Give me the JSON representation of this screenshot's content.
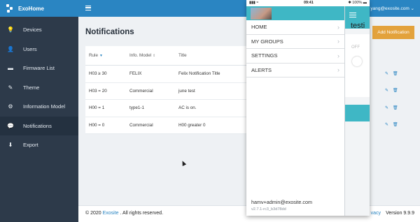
{
  "app": {
    "name": "ExoHome"
  },
  "topbar": {
    "user_email": "yang@exosite.com ⌄"
  },
  "sidebar": {
    "items": [
      {
        "label": "Devices",
        "icon": "lightbulb-icon",
        "glyph": "💡"
      },
      {
        "label": "Users",
        "icon": "user-icon",
        "glyph": "👤"
      },
      {
        "label": "Firmware List",
        "icon": "folder-icon",
        "glyph": "▬"
      },
      {
        "label": "Theme",
        "icon": "wand-icon",
        "glyph": "✎"
      },
      {
        "label": "Information Model",
        "icon": "cubes-icon",
        "glyph": "⚙"
      },
      {
        "label": "Notifications",
        "icon": "comment-icon",
        "glyph": "💬"
      },
      {
        "label": "Export",
        "icon": "download-icon",
        "glyph": "⬇"
      }
    ],
    "active_index": 5
  },
  "main": {
    "title": "Notifications",
    "add_button": "Add Notification",
    "table": {
      "headers": {
        "rule": "Rule",
        "model": "Info. Model",
        "title": "Title"
      },
      "rows": [
        {
          "rule": "H03 ≥ 30",
          "model": "FELIX",
          "title": "Felix Notification Title"
        },
        {
          "rule": "H03 = 20",
          "model": "Commercial",
          "title": "june test"
        },
        {
          "rule": "H00 = 1",
          "model": "type1-1",
          "title": "AC is on."
        },
        {
          "rule": "H00 = 0",
          "model": "Commercial",
          "title": "H00 greater 0"
        }
      ]
    }
  },
  "footer": {
    "copyright_prefix": "© 2020 ",
    "company": "Exosite",
    "copyright_suffix": " . All rights reserved.",
    "privacy": "vacy",
    "version": "Version 9.9.9"
  },
  "phone": {
    "status": {
      "left": "▮▮▮ ≈",
      "time": "09:41",
      "right": "✱ 100% ▬"
    },
    "menu": [
      "HOME",
      "MY GROUPS",
      "SETTINGS",
      "ALERTS"
    ],
    "email": "hamv+admin@exosite.com",
    "version": "v2.7.1-rc3_b3d78dd",
    "peek_title": "testi",
    "peek_toggle_label": "OFF"
  },
  "colors": {
    "brand": "#2a85c2",
    "sidebar": "#2d3a4a",
    "accent": "#e3a23c",
    "teal": "#3fb7c5"
  }
}
